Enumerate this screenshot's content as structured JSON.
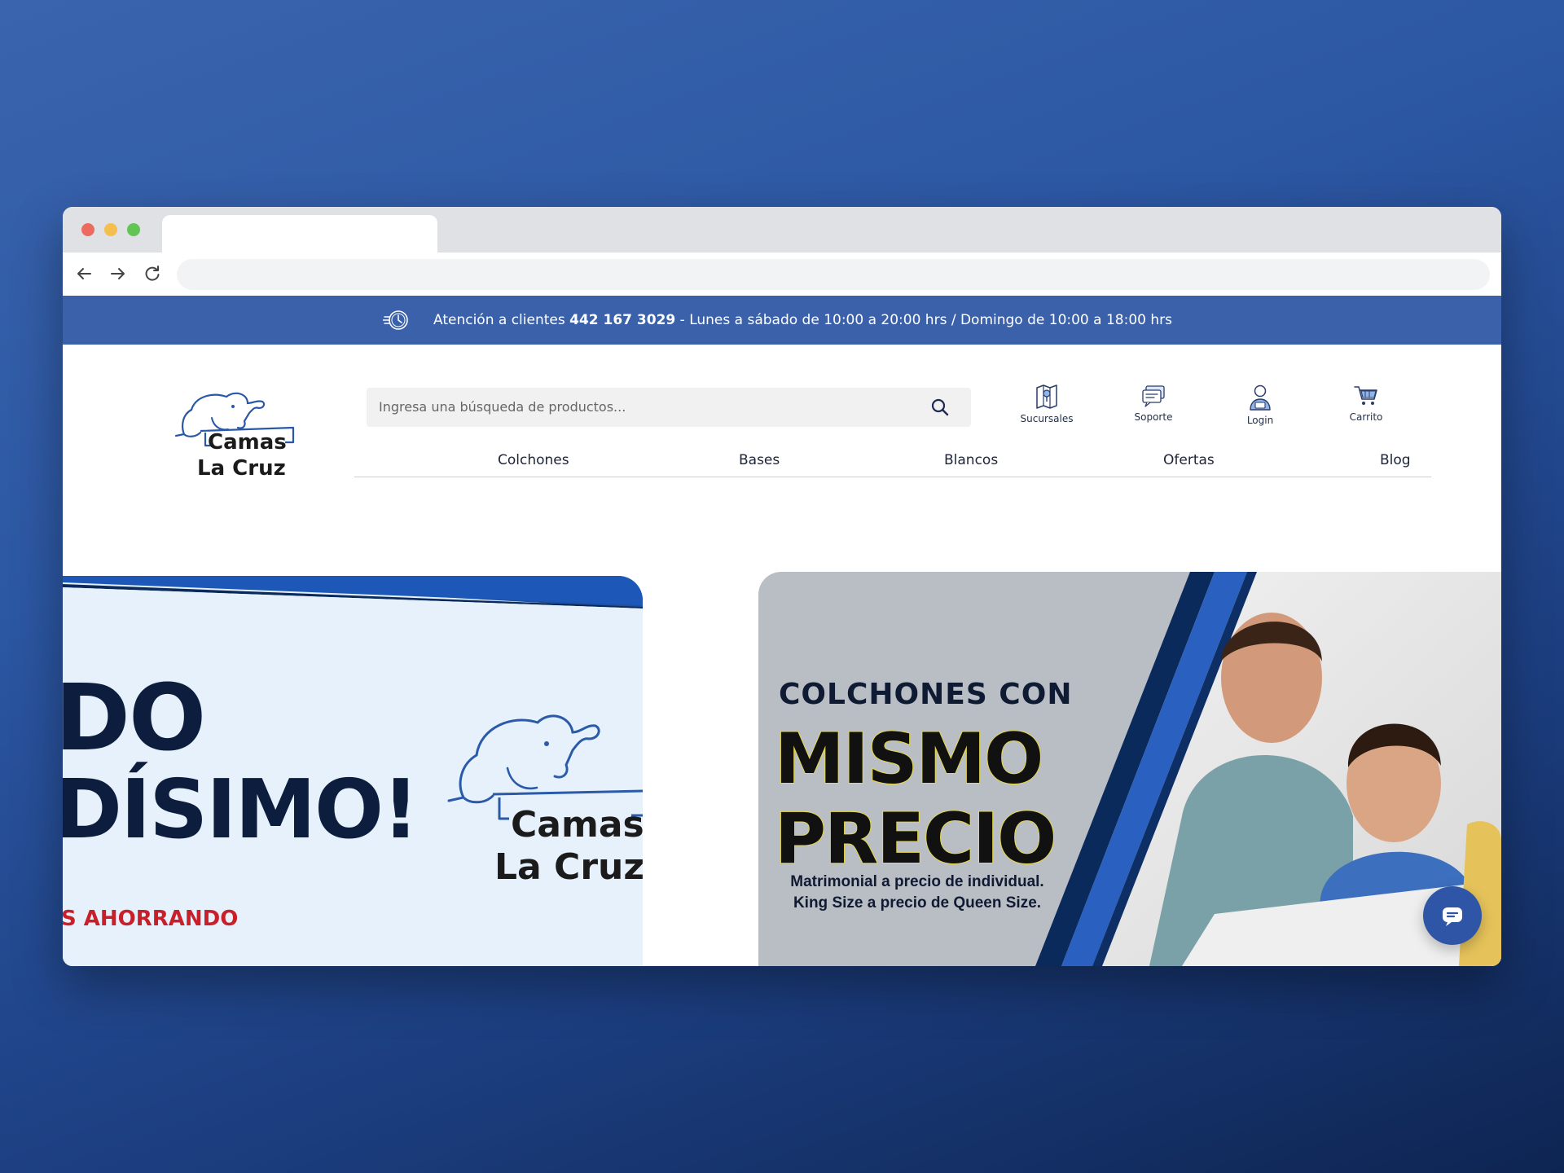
{
  "topbar": {
    "prefix": "Atención a clientes",
    "phone": "442 167 3029",
    "hours": "- Lunes a sábado de 10:00 a 20:00 hrs / Domingo de 10:00 a 18:00 hrs"
  },
  "logo": {
    "line1": "Camas",
    "line2": "La Cruz"
  },
  "search": {
    "placeholder": "Ingresa una búsqueda de productos..."
  },
  "header_icons": {
    "sucursales": "Sucursales",
    "soporte": "Soporte",
    "login": "Login",
    "carrito": "Carrito"
  },
  "nav": {
    "items": [
      "Colchones",
      "Bases",
      "Blancos",
      "Ofertas",
      "Blog"
    ]
  },
  "banner_left": {
    "line1": "DO",
    "line2": "DÍSIMO!",
    "line3": "S AHORRANDO",
    "logo_line1": "Camas",
    "logo_line2": "La Cruz"
  },
  "banner_right": {
    "line1": "COLCHONES CON",
    "line2": "MISMO",
    "line3": "PRECIO",
    "sub1": "Matrimonial a precio de individual.",
    "sub2": "King Size a precio de Queen Size."
  },
  "colors": {
    "topbar": "#3a61aa",
    "brand_blue": "#1f4fa0",
    "dark_navy": "#0d1d3d",
    "accent_red": "#c8202a",
    "highlight_yellow": "#e6d84a"
  },
  "icons": [
    "clock-icon",
    "search-icon",
    "store-map-icon",
    "support-chat-icon",
    "user-icon",
    "cart-icon",
    "chat-icon"
  ]
}
